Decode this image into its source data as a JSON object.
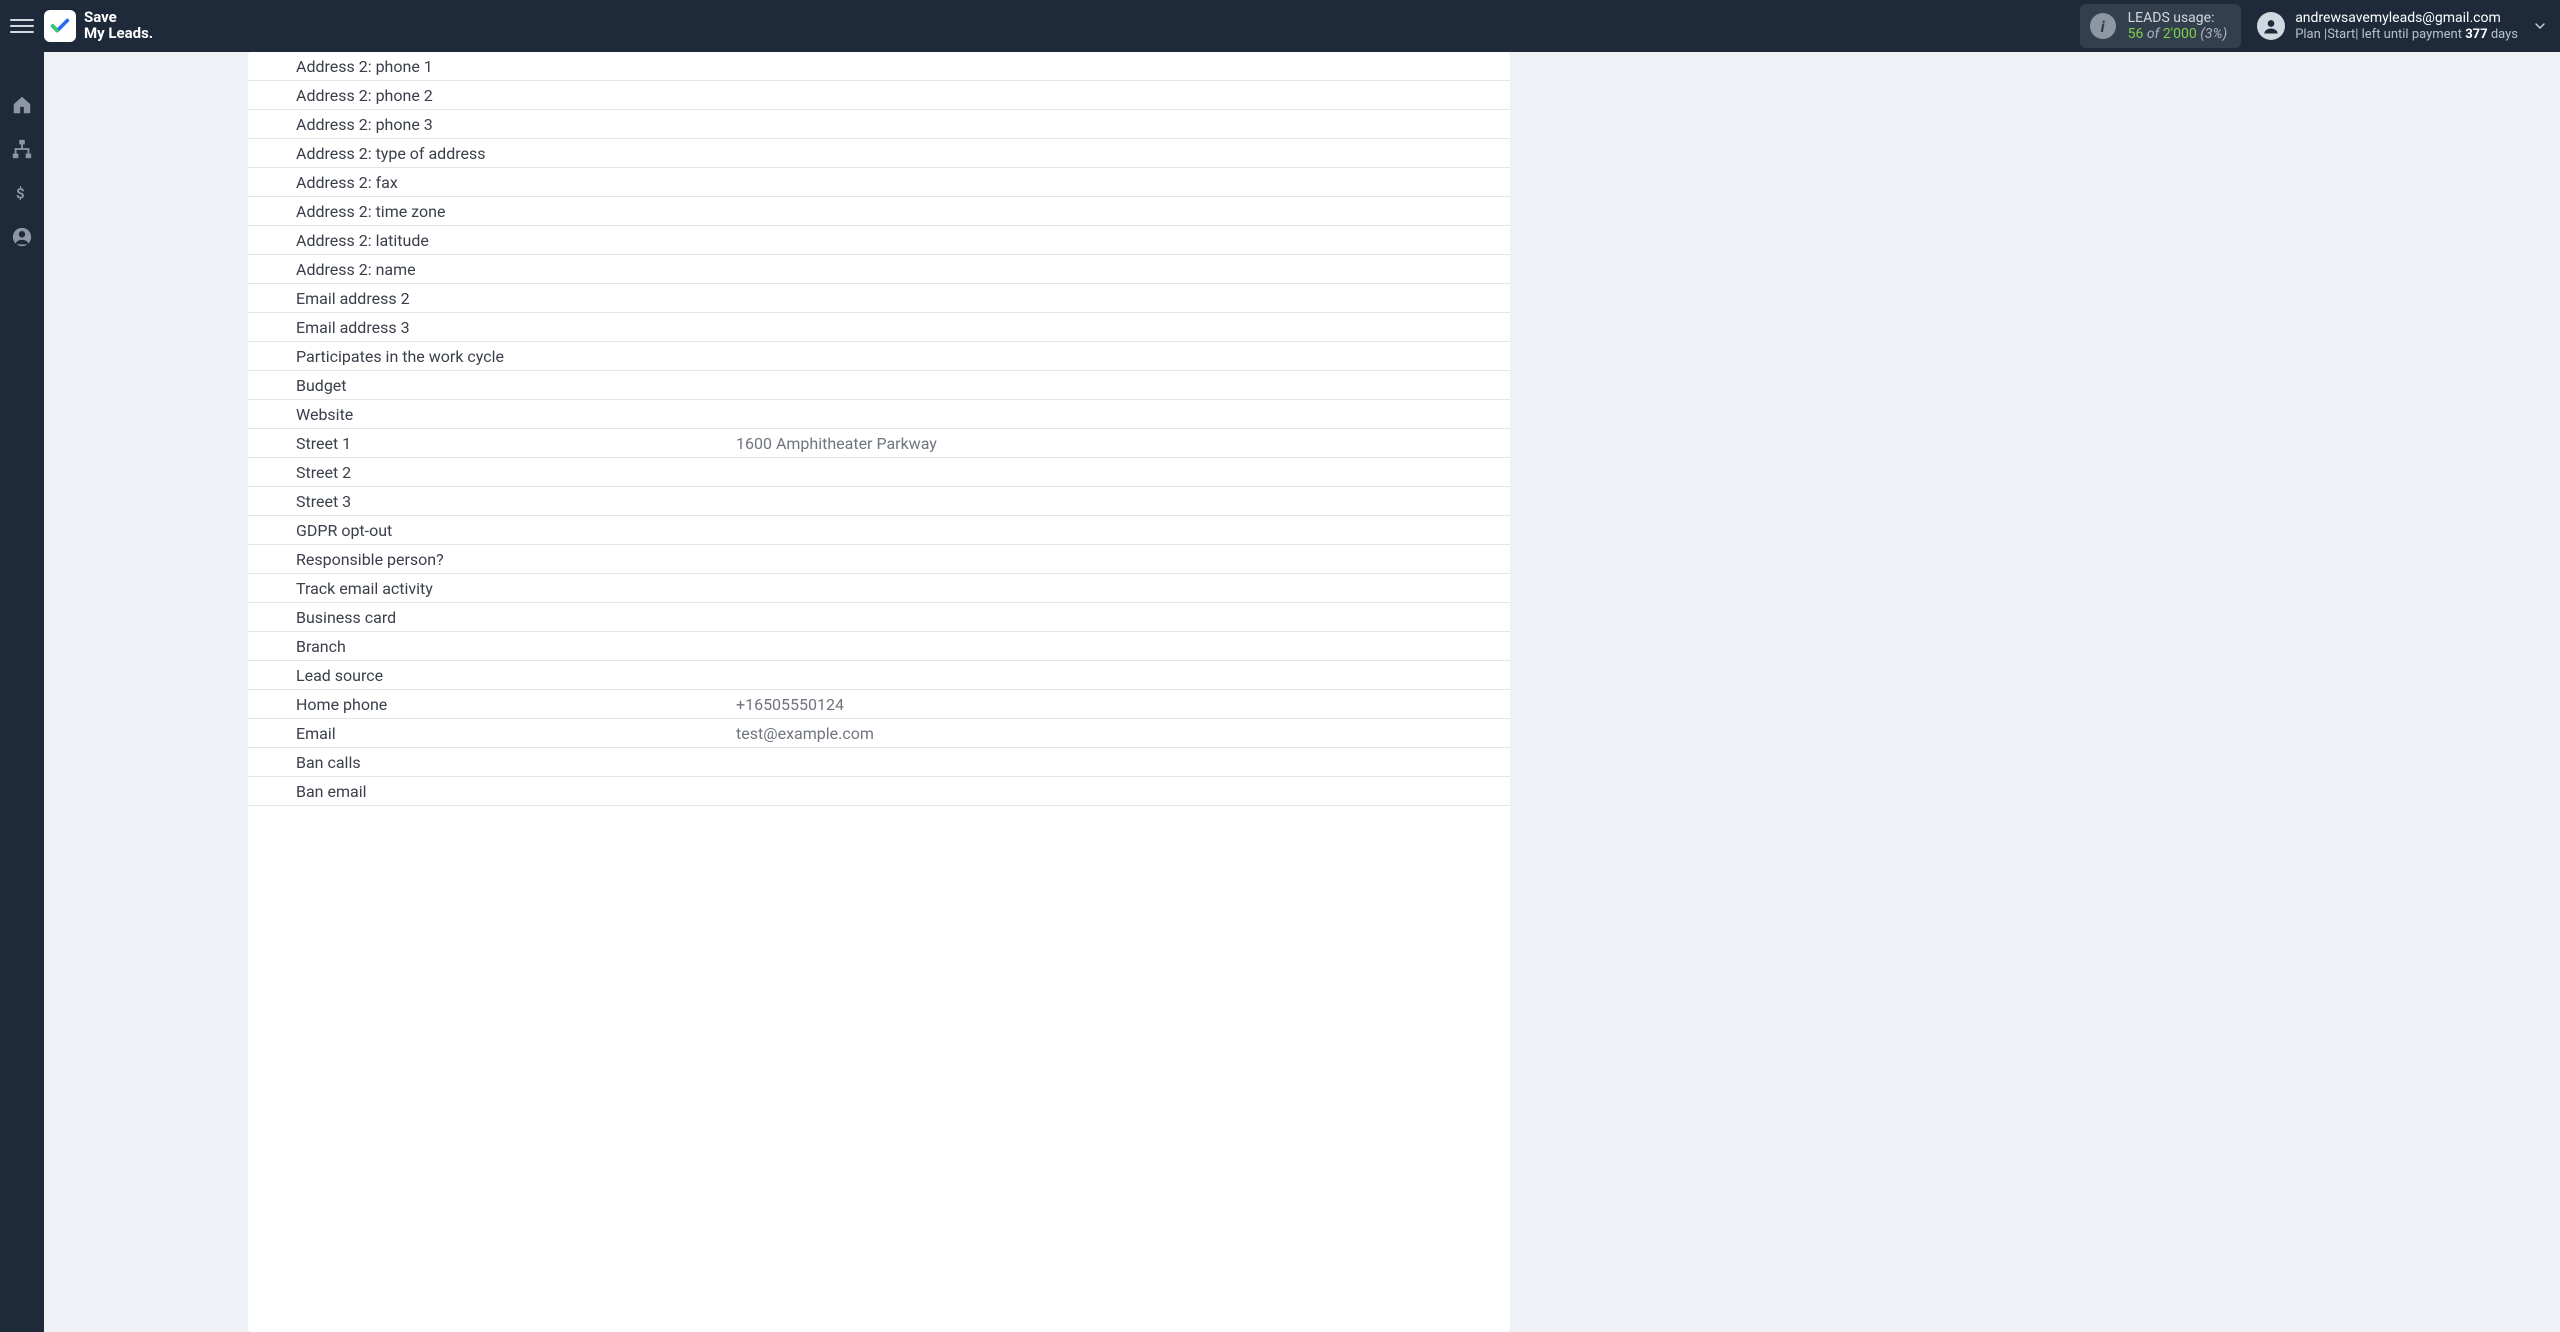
{
  "header": {
    "app_name_line1": "Save",
    "app_name_line2": "My Leads.",
    "leads_label": "LEADS usage:",
    "leads_used": "56",
    "leads_of": "of",
    "leads_quota": "2'000",
    "leads_pct": "(3%)",
    "account_email": "andrewsavemyleads@gmail.com",
    "plan_prefix": "Plan |Start| left until payment ",
    "plan_days": "377",
    "plan_suffix": " days"
  },
  "rows": [
    {
      "label": "Address 2: phone 1",
      "value": ""
    },
    {
      "label": "Address 2: phone 2",
      "value": ""
    },
    {
      "label": "Address 2: phone 3",
      "value": ""
    },
    {
      "label": "Address 2: type of address",
      "value": ""
    },
    {
      "label": "Address 2: fax",
      "value": ""
    },
    {
      "label": "Address 2: time zone",
      "value": ""
    },
    {
      "label": "Address 2: latitude",
      "value": ""
    },
    {
      "label": "Address 2: name",
      "value": ""
    },
    {
      "label": "Email address 2",
      "value": ""
    },
    {
      "label": "Email address 3",
      "value": ""
    },
    {
      "label": "Participates in the work cycle",
      "value": ""
    },
    {
      "label": "Budget",
      "value": ""
    },
    {
      "label": "Website",
      "value": ""
    },
    {
      "label": "Street 1",
      "value": "1600 Amphitheater Parkway"
    },
    {
      "label": "Street 2",
      "value": ""
    },
    {
      "label": "Street 3",
      "value": ""
    },
    {
      "label": "GDPR opt-out",
      "value": ""
    },
    {
      "label": "Responsible person?",
      "value": ""
    },
    {
      "label": "Track email activity",
      "value": ""
    },
    {
      "label": "Business card",
      "value": ""
    },
    {
      "label": "Branch",
      "value": ""
    },
    {
      "label": "Lead source",
      "value": ""
    },
    {
      "label": "Home phone",
      "value": "+16505550124"
    },
    {
      "label": "Email",
      "value": "test@example.com"
    },
    {
      "label": "Ban calls",
      "value": ""
    },
    {
      "label": "Ban email",
      "value": ""
    }
  ]
}
